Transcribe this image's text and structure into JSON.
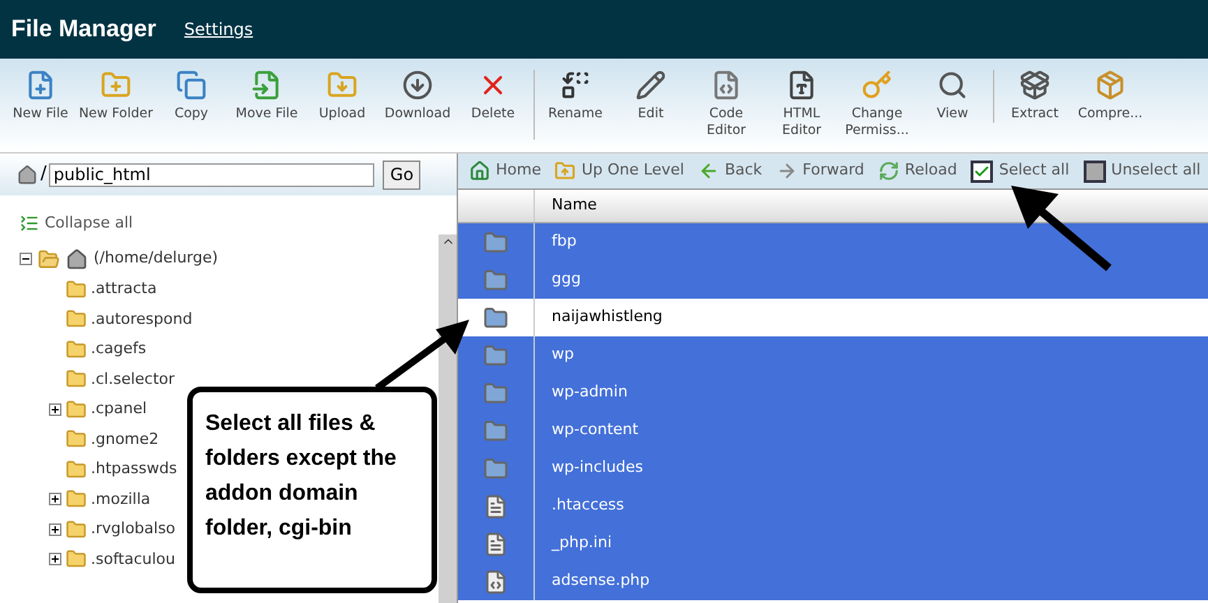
{
  "header": {
    "title": "File Manager",
    "link": "Settings"
  },
  "toolbar": [
    [
      {
        "label": "New File"
      },
      {
        "label": "New Folder"
      },
      {
        "label": "Copy"
      },
      {
        "label": "Move File"
      },
      {
        "label": "Upload"
      },
      {
        "label": "Download"
      },
      {
        "label": "Delete"
      }
    ],
    [
      {
        "label": "Rename"
      },
      {
        "label": "Edit"
      },
      {
        "label": "Code Editor"
      },
      {
        "label": "HTML Editor"
      },
      {
        "label": "Change Permiss..."
      },
      {
        "label": "View"
      }
    ],
    [
      {
        "label": "Extract"
      },
      {
        "label": "Compre..."
      }
    ]
  ],
  "path": {
    "prefix": "/",
    "value": "public_html",
    "button": "Go"
  },
  "collapse_all": "Collapse all",
  "tree": {
    "label": "(/home/delurge)",
    "expanded": true,
    "children": [
      {
        "label": ".attracta",
        "expandable": false
      },
      {
        "label": ".autorespond",
        "expandable": false
      },
      {
        "label": ".cagefs",
        "expandable": false
      },
      {
        "label": ".cl.selector",
        "expandable": false
      },
      {
        "label": ".cpanel",
        "expandable": true
      },
      {
        "label": ".gnome2",
        "expandable": false
      },
      {
        "label": ".htpasswds",
        "expandable": false
      },
      {
        "label": ".mozilla",
        "expandable": true
      },
      {
        "label": ".rvglobalso",
        "expandable": true
      },
      {
        "label": ".softaculou",
        "expandable": true
      }
    ]
  },
  "nav": [
    {
      "label": "Home",
      "kind": "link"
    },
    {
      "label": "Up One Level",
      "kind": "link"
    },
    {
      "label": "Back",
      "kind": "link"
    },
    {
      "label": "Forward",
      "kind": "link"
    },
    {
      "label": "Reload",
      "kind": "link"
    },
    {
      "label": "Select all",
      "kind": "checkbox",
      "checked": true
    },
    {
      "label": "Unselect all",
      "kind": "checkbox",
      "checked": false
    }
  ],
  "table": {
    "columns": [
      "Name"
    ],
    "rows": [
      {
        "name": "fbp",
        "kind": "folder",
        "selected": true
      },
      {
        "name": "ggg",
        "kind": "folder",
        "selected": true
      },
      {
        "name": "naijawhistleng",
        "kind": "folder",
        "selected": false
      },
      {
        "name": "wp",
        "kind": "folder",
        "selected": true
      },
      {
        "name": "wp-admin",
        "kind": "folder",
        "selected": true
      },
      {
        "name": "wp-content",
        "kind": "folder",
        "selected": true
      },
      {
        "name": "wp-includes",
        "kind": "folder",
        "selected": true
      },
      {
        "name": ".htaccess",
        "kind": "file",
        "selected": true
      },
      {
        "name": "_php.ini",
        "kind": "file",
        "selected": true
      },
      {
        "name": "adsense.php",
        "kind": "php",
        "selected": true
      }
    ]
  },
  "callout": "Select all files & folders except the addon domain folder, cgi-bin"
}
